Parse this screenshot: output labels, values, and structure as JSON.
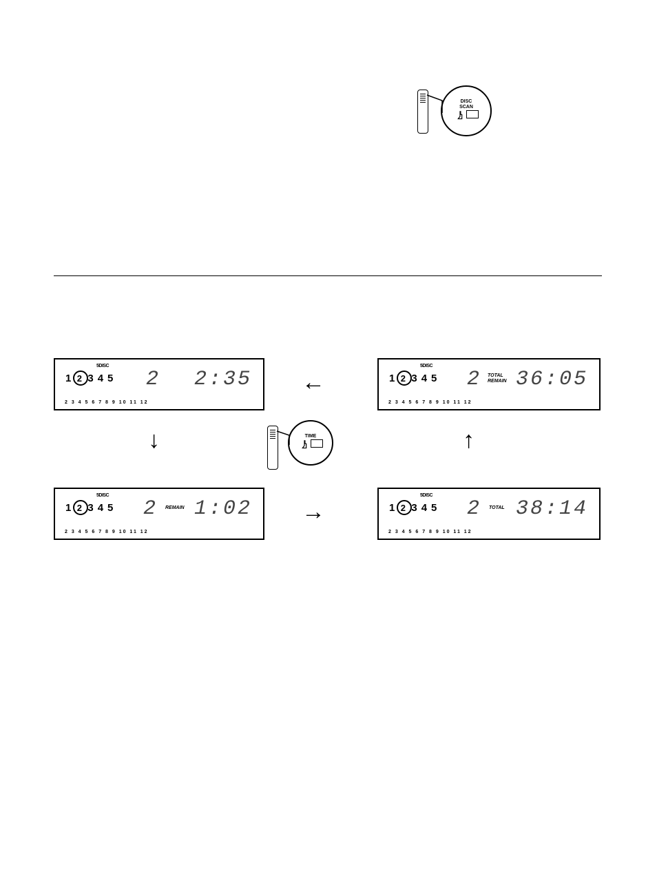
{
  "remote_buttons": {
    "disc_scan_label": "DISC\nSCAN",
    "time_label": "TIME"
  },
  "lcd_common": {
    "five_disc": "5DISC",
    "disc_numbers": [
      "1",
      "2",
      "3",
      "4",
      "5"
    ],
    "active_disc": "2",
    "track_row": "2  3  4  5  6  7  8  9  10  11 12"
  },
  "panels": {
    "top_left": {
      "track": "2",
      "mode": "",
      "time": "2:35"
    },
    "top_right": {
      "track": "2",
      "mode": "TOTAL\nREMAIN",
      "time": "36:05"
    },
    "bottom_left": {
      "track": "2",
      "mode": "REMAIN",
      "time": "1:02"
    },
    "bottom_right": {
      "track": "2",
      "mode": "TOTAL",
      "time": "38:14"
    }
  }
}
